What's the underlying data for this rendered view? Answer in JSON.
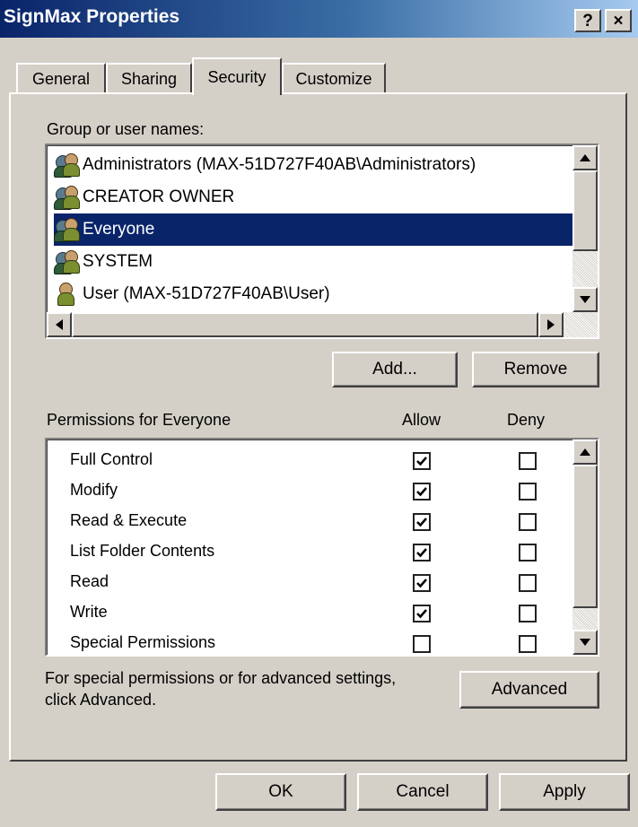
{
  "window": {
    "title": "SignMax Properties",
    "help_label": "?",
    "close_label": "×"
  },
  "tabs": [
    {
      "label": "General",
      "active": false
    },
    {
      "label": "Sharing",
      "active": false
    },
    {
      "label": "Security",
      "active": true
    },
    {
      "label": "Customize",
      "active": false
    }
  ],
  "security": {
    "group_label": "Group or user names:",
    "users": [
      {
        "name": "Administrators (MAX-51D727F40AB\\Administrators)",
        "icon": "group-icon",
        "selected": false
      },
      {
        "name": "CREATOR OWNER",
        "icon": "group-icon",
        "selected": false
      },
      {
        "name": "Everyone",
        "icon": "group-icon",
        "selected": true
      },
      {
        "name": "SYSTEM",
        "icon": "group-icon",
        "selected": false
      },
      {
        "name": "User (MAX-51D727F40AB\\User)",
        "icon": "user-icon",
        "selected": false
      }
    ],
    "add_label": "Add...",
    "remove_label": "Remove",
    "permissions_label": "Permissions for Everyone",
    "allow_label": "Allow",
    "deny_label": "Deny",
    "permissions": [
      {
        "name": "Full Control",
        "allow": true,
        "deny": false
      },
      {
        "name": "Modify",
        "allow": true,
        "deny": false
      },
      {
        "name": "Read & Execute",
        "allow": true,
        "deny": false
      },
      {
        "name": "List Folder Contents",
        "allow": true,
        "deny": false
      },
      {
        "name": "Read",
        "allow": true,
        "deny": false
      },
      {
        "name": "Write",
        "allow": true,
        "deny": false
      },
      {
        "name": "Special Permissions",
        "allow": false,
        "deny": false
      }
    ],
    "advanced_note_line1": "For special permissions or for advanced settings,",
    "advanced_note_line2": "click Advanced.",
    "advanced_label": "Advanced"
  },
  "footer": {
    "ok_label": "OK",
    "cancel_label": "Cancel",
    "apply_label": "Apply"
  },
  "colors": {
    "selection": "#0a246a",
    "face": "#d4d0c8",
    "title_start": "#0a246a",
    "title_end": "#a6caf0"
  }
}
